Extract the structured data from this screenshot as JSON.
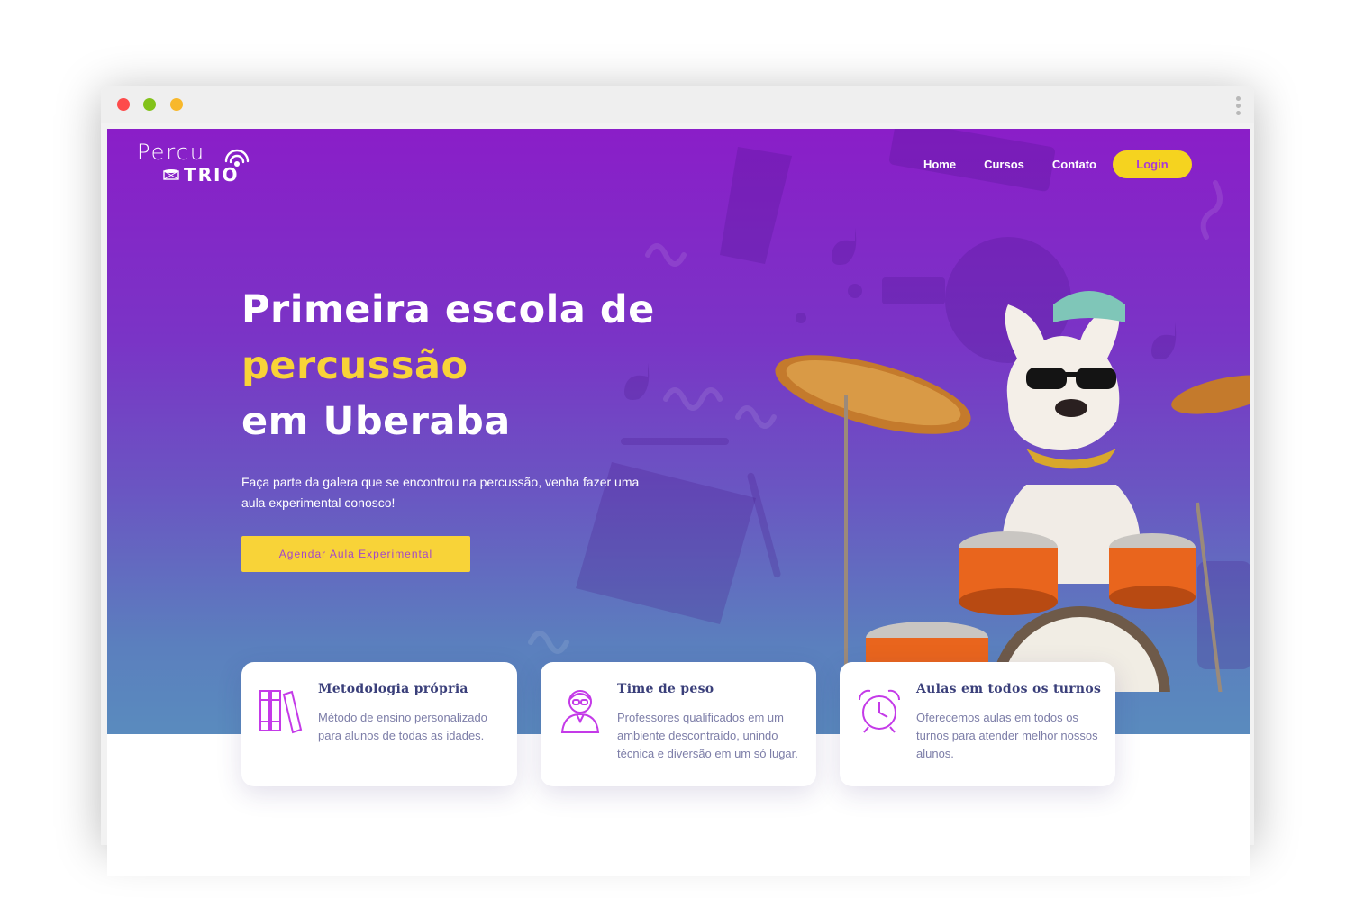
{
  "window": {
    "controls": [
      "close",
      "minimize",
      "maximize"
    ],
    "menu_icon": "kebab-icon"
  },
  "brand": {
    "logo_top": "Percu",
    "logo_bottom": "TRIO"
  },
  "nav": {
    "items": [
      "Home",
      "Cursos",
      "Contato"
    ],
    "login": "Login"
  },
  "hero": {
    "title_line1": "Primeira escola de",
    "title_accent": "percussão",
    "title_line3": "em Uberaba",
    "subtitle": "Faça parte da galera que se encontrou na percussão, venha fazer uma aula experimental conosco!",
    "cta": "Agendar Aula Experimental"
  },
  "features": [
    {
      "icon": "books-icon",
      "title": "Metodologia própria",
      "text": "Método de ensino personalizado para alunos de todas as idades."
    },
    {
      "icon": "teacher-icon",
      "title": "Time de peso",
      "text": "Professores qualificados em um ambiente descontraído, unindo técnica e diversão em um só lugar."
    },
    {
      "icon": "alarm-clock-icon",
      "title": "Aulas em todos os turnos",
      "text": "Oferecemos aulas em todos os turnos para atender melhor nossos alunos."
    }
  ],
  "colors": {
    "purple": "#8a1ec8",
    "yellow": "#f8d338",
    "card_title": "#3a3f7a",
    "icon": "#c43ae8"
  }
}
